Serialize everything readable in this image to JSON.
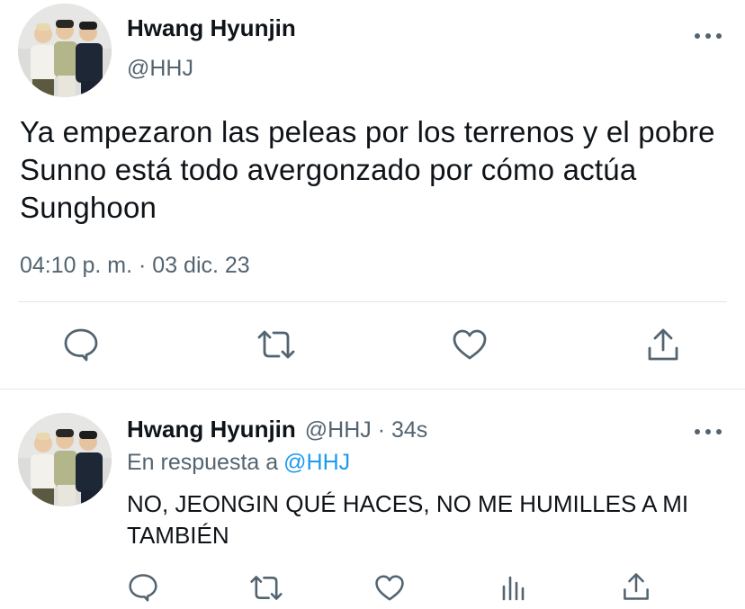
{
  "main_tweet": {
    "display_name": "Hwang Hyunjin",
    "handle": "@HHJ",
    "avatar_icon": "group-photo-avatar",
    "more_icon": "more-horizontal-icon",
    "text": "Ya empezaron las peleas por los terrenos y el pobre Sunno está todo avergonzado por cómo actúa Sunghoon",
    "timestamp": "04:10 p. m. · 03 dic. 23",
    "actions": [
      "reply-icon",
      "retweet-icon",
      "like-icon",
      "share-icon"
    ]
  },
  "reply_tweet": {
    "display_name": "Hwang Hyunjin",
    "handle_time": "@HHJ · 34s",
    "replying_prefix": "En respuesta a",
    "replying_to": "@HHJ",
    "text": "NO, JEONGIN QUÉ HACES, NO ME HUMILLES A MI TAMBIÉN",
    "actions": [
      "reply-icon",
      "retweet-icon",
      "like-icon",
      "analytics-icon",
      "share-icon"
    ]
  },
  "colors": {
    "text": "#0f1419",
    "secondary": "#536471",
    "link": "#1d9bf0",
    "divider": "#e1e5e8"
  }
}
